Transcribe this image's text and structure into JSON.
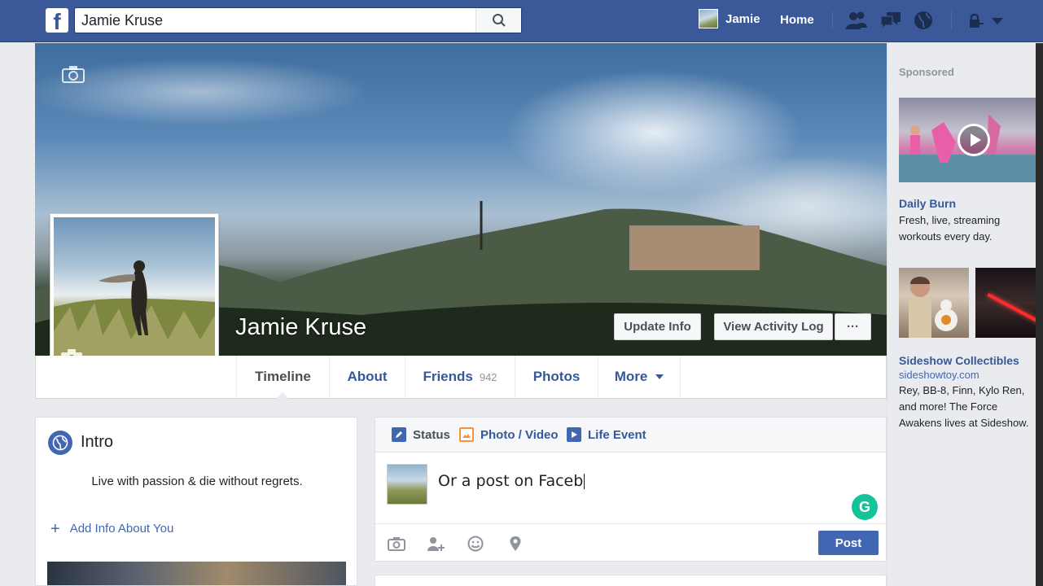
{
  "topbar": {
    "logo": "f",
    "search_value": "Jamie Kruse",
    "user_name": "Jamie",
    "home_label": "Home",
    "icons": [
      "friend-requests-icon",
      "messages-icon",
      "notifications-globe-icon",
      "privacy-lock-icon",
      "account-menu-caret-icon"
    ]
  },
  "profile": {
    "name": "Jamie Kruse",
    "buttons": {
      "update_info": "Update Info",
      "activity_log": "View Activity Log",
      "more": "···"
    }
  },
  "tabs": [
    {
      "label": "Timeline",
      "active": true
    },
    {
      "label": "About"
    },
    {
      "label": "Friends",
      "count": "942"
    },
    {
      "label": "Photos"
    },
    {
      "label": "More"
    }
  ],
  "intro": {
    "title": "Intro",
    "bio": "Live with passion & die without regrets.",
    "add_info": "Add Info About You"
  },
  "composer": {
    "tabs": [
      {
        "label": "Status",
        "active": true,
        "icon": "pencil-icon"
      },
      {
        "label": "Photo / Video",
        "icon": "photo-icon"
      },
      {
        "label": "Life Event",
        "icon": "flag-icon"
      }
    ],
    "input_value": "Or a post on Faceb",
    "grammarly": "G",
    "actions": [
      "camera-icon",
      "tag-friends-icon",
      "feeling-icon",
      "location-icon"
    ],
    "post_label": "Post"
  },
  "sidebar": {
    "sponsored_label": "Sponsored",
    "ads": [
      {
        "title": "Daily Burn",
        "text": "Fresh, live, streaming workouts every day."
      },
      {
        "title": "Sideshow Collectibles",
        "url": "sideshowtoy.com",
        "text": "Rey, BB-8, Finn, Kylo Ren, and more! The Force Awakens lives at Sideshow."
      }
    ]
  },
  "colors": {
    "brand_blue": "#3b5998",
    "link_blue": "#365899",
    "post_button": "#4267b2",
    "grammarly_green": "#15c39a"
  }
}
